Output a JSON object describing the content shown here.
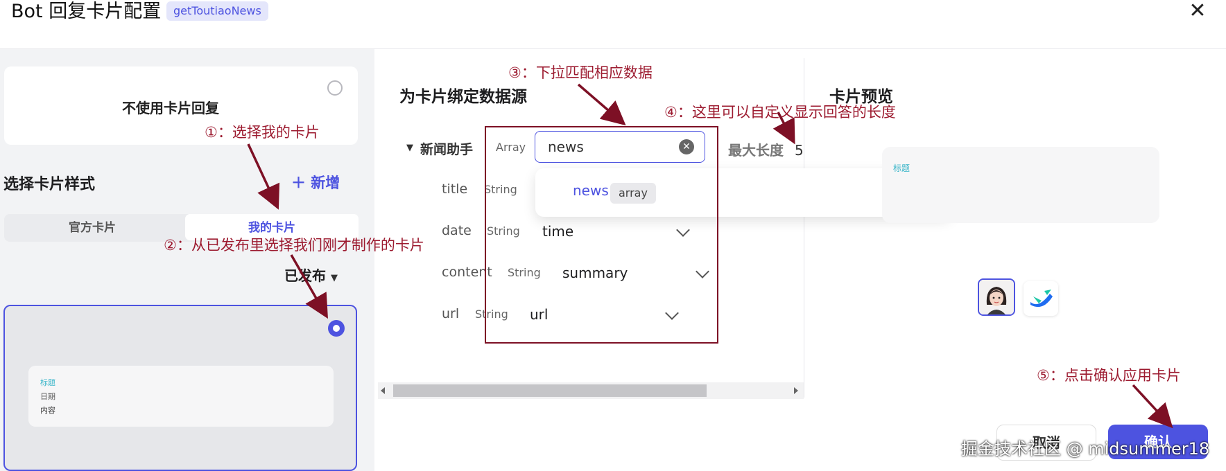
{
  "header": {
    "title": "Bot 回复卡片配置",
    "tag": "getToutiaoNews",
    "close_icon": "close-icon"
  },
  "left_panel": {
    "no_card_label": "不使用卡片回复",
    "section_title": "选择卡片样式",
    "add_button": "＋ 新增",
    "tabs": [
      {
        "label": "官方卡片",
        "active": false
      },
      {
        "label": "我的卡片",
        "active": true
      }
    ],
    "filter": "已发布",
    "card_preview": {
      "lines": [
        "标题",
        "日期",
        "内容"
      ]
    }
  },
  "middle_panel": {
    "title": "为卡片绑定数据源",
    "group": {
      "name": "新闻助手",
      "type": "Array",
      "value": "news",
      "max_length_label": "最大长度",
      "max_length_value": "5"
    },
    "dropdown": {
      "option": "news",
      "badge": "array"
    },
    "fields": [
      {
        "name": "title",
        "type": "String",
        "value": ""
      },
      {
        "name": "date",
        "type": "String",
        "value": "time"
      },
      {
        "name": "content",
        "type": "String",
        "value": "summary"
      },
      {
        "name": "url",
        "type": "String",
        "value": "url"
      }
    ]
  },
  "right_panel": {
    "title": "卡片预览",
    "preview_label": "标题",
    "cancel_button": "取消",
    "confirm_button": "确认"
  },
  "annotations": {
    "a1": "①：选择我的卡片",
    "a2": "②：从已发布里选择我们刚才制作的卡片",
    "a3": "③：下拉匹配相应数据",
    "a4": "④：这里可以自定义显示回答的长度",
    "a5": "⑤：点击确认应用卡片"
  },
  "watermark": "掘金技术社区 @ midsummer18",
  "colors": {
    "accent": "#4d53e0",
    "annotation": "#9c1a2f",
    "box": "#7d1025"
  }
}
